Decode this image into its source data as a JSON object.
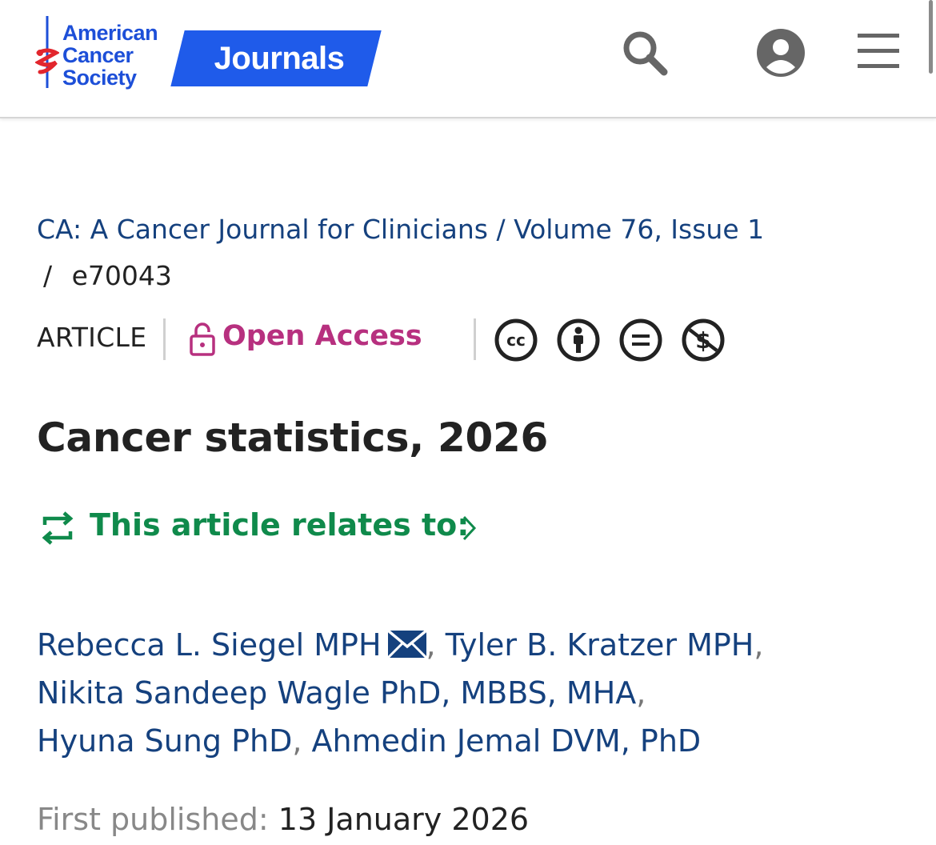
{
  "header": {
    "logo_lines": [
      "American",
      "Cancer",
      "Society"
    ],
    "journals_label": "Journals",
    "icons": [
      "search-icon",
      "account-icon",
      "menu-icon"
    ]
  },
  "breadcrumb": {
    "journal": "CA: A Cancer Journal for Clinicians",
    "separator": "/",
    "volume_issue": "Volume 76, Issue 1",
    "article_id": "e70043"
  },
  "meta": {
    "article_type": "ARTICLE",
    "access": "Open Access",
    "license_icons": [
      "cc-icon",
      "attribution-icon",
      "no-derivatives-icon",
      "non-commercial-icon"
    ]
  },
  "article": {
    "title": "Cancer statistics, 2026",
    "relates_label": "This article relates to:"
  },
  "authors": [
    {
      "name": "Rebecca L. Siegel MPH",
      "corresponding": true
    },
    {
      "name": "Tyler B. Kratzer MPH"
    },
    {
      "name": "Nikita Sandeep Wagle PhD, MBBS, MHA"
    },
    {
      "name": "Hyuna Sung PhD"
    },
    {
      "name": "Ahmedin Jemal DVM, PhD"
    }
  ],
  "published": {
    "label": "First published:",
    "date": "13 January 2026"
  },
  "colors": {
    "brand_blue": "#1f5bea",
    "link_navy": "#15417e",
    "open_access_magenta": "#b7307f",
    "relates_green": "#0f8a4b"
  }
}
